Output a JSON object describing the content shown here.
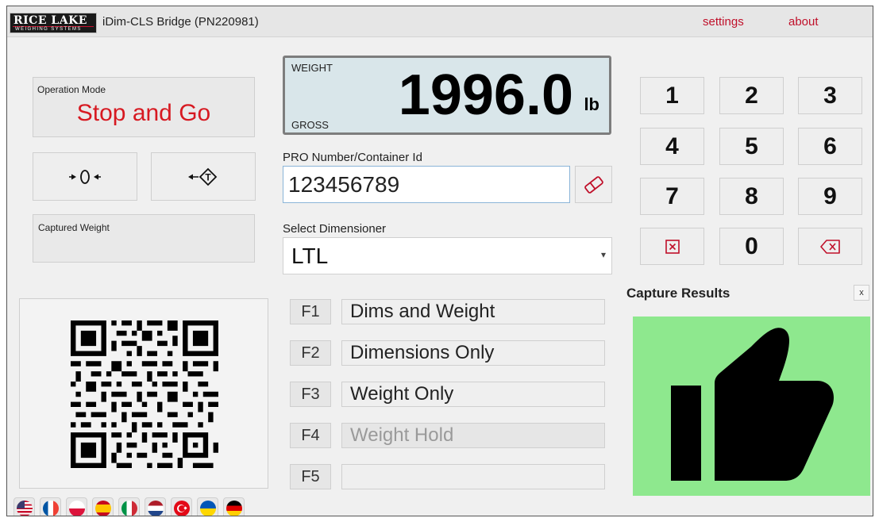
{
  "header": {
    "logo_text": "RICE LAKE",
    "logo_subtext": "WEIGHING SYSTEMS",
    "title": "iDim-CLS Bridge (PN220981)",
    "nav": [
      {
        "label": "settings"
      },
      {
        "label": "about"
      }
    ]
  },
  "operation_mode": {
    "label": "Operation Mode",
    "value": "Stop and Go"
  },
  "captured_weight": {
    "label": "Captured Weight",
    "value": ""
  },
  "weight_display": {
    "label": "WEIGHT",
    "mode": "GROSS",
    "value": "1996.0",
    "unit": "lb"
  },
  "pro_number": {
    "label": "PRO Number/Container Id",
    "value": "123456789"
  },
  "dimensioner": {
    "label": "Select Dimensioner",
    "selected": "LTL"
  },
  "function_buttons": [
    {
      "key": "F1",
      "label": "Dims and Weight",
      "enabled": true
    },
    {
      "key": "F2",
      "label": "Dimensions Only",
      "enabled": true
    },
    {
      "key": "F3",
      "label": "Weight Only",
      "enabled": true
    },
    {
      "key": "F4",
      "label": "Weight Hold",
      "enabled": false
    },
    {
      "key": "F5",
      "label": "",
      "enabled": true
    }
  ],
  "keypad": {
    "keys": [
      "1",
      "2",
      "3",
      "4",
      "5",
      "6",
      "7",
      "8",
      "9",
      "0"
    ]
  },
  "capture_results": {
    "title": "Capture Results",
    "close_label": "x",
    "status_color": "#8ee88e",
    "icon": "thumbs-up-icon"
  },
  "languages": [
    {
      "name": "english",
      "icon": "us-flag-icon"
    },
    {
      "name": "french",
      "icon": "fr-flag-icon"
    },
    {
      "name": "polish",
      "icon": "pl-flag-icon"
    },
    {
      "name": "spanish",
      "icon": "es-flag-icon"
    },
    {
      "name": "italian",
      "icon": "it-flag-icon"
    },
    {
      "name": "dutch",
      "icon": "nl-flag-icon"
    },
    {
      "name": "turkish",
      "icon": "tr-flag-icon"
    },
    {
      "name": "ukrainian",
      "icon": "ua-flag-icon"
    },
    {
      "name": "german",
      "icon": "de-flag-icon"
    }
  ],
  "colors": {
    "brand_red": "#c0102a",
    "success_green": "#8ee88e",
    "weight_bg": "#d9e6ea"
  }
}
